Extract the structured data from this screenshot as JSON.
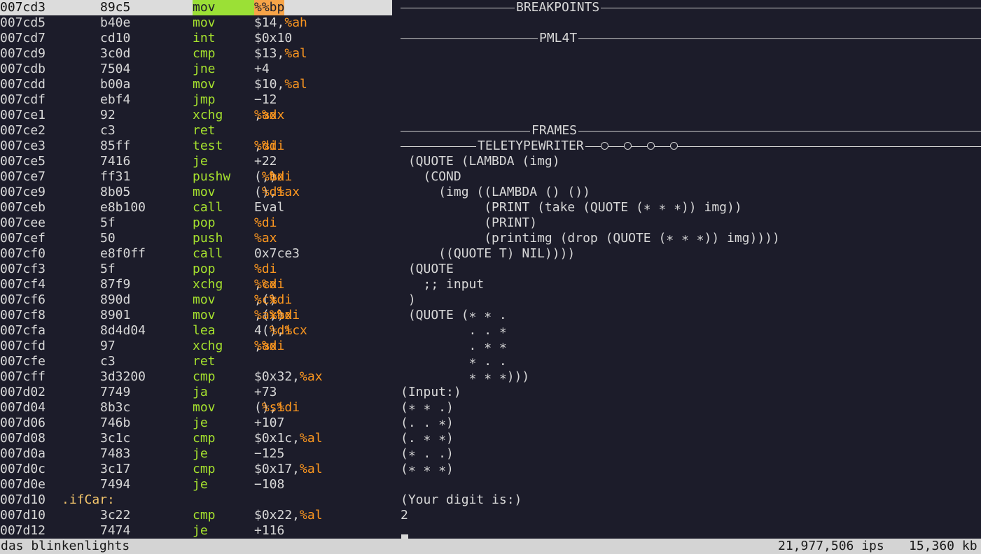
{
  "disassembly": {
    "rows": [
      {
        "addr": "007cd3",
        "hex": "89c5",
        "mn": "mov",
        "op": "<span class=\"reg hl\">%ax</span>,<span class=\"reg hl\">%bp</span>",
        "current": true
      },
      {
        "addr": "007cd5",
        "hex": "b40e",
        "mn": "mov",
        "op": "$14,<span class=\"reg\">%ah</span>"
      },
      {
        "addr": "007cd7",
        "hex": "cd10",
        "mn": "int",
        "op": "$0x10"
      },
      {
        "addr": "007cd9",
        "hex": "3c0d",
        "mn": "cmp",
        "op": "$13,<span class=\"reg\">%al</span>"
      },
      {
        "addr": "007cdb",
        "hex": "7504",
        "mn": "jne",
        "op": "+4"
      },
      {
        "addr": "007cdd",
        "hex": "b00a",
        "mn": "mov",
        "op": "$10,<span class=\"reg\">%al</span>"
      },
      {
        "addr": "007cdf",
        "hex": "ebf4",
        "mn": "jmp",
        "op": "−12"
      },
      {
        "addr": "007ce1",
        "hex": "92",
        "mn": "xchg",
        "op": "<span class=\"reg\">%ax</span>,<span class=\"reg\">%dx</span>"
      },
      {
        "addr": "007ce2",
        "hex": "c3",
        "mn": "ret",
        "op": ""
      },
      {
        "addr": "007ce3",
        "hex": "85ff",
        "mn": "test",
        "op": "<span class=\"reg\">%di</span>,<span class=\"reg\">%di</span>"
      },
      {
        "addr": "007ce5",
        "hex": "7416",
        "mn": "je",
        "op": "+22"
      },
      {
        "addr": "007ce7",
        "hex": "ff31",
        "mn": "pushw",
        "op": "(<span class=\"reg\">%bx</span>,<span class=\"reg\">%di</span>)"
      },
      {
        "addr": "007ce9",
        "hex": "8b05",
        "mn": "mov",
        "op": "(<span class=\"reg\">%di</span>),<span class=\"reg\">%ax</span>"
      },
      {
        "addr": "007ceb",
        "hex": "e8b100",
        "mn": "call",
        "op": "Eval"
      },
      {
        "addr": "007cee",
        "hex": "5f",
        "mn": "pop",
        "op": "<span class=\"reg\">%di</span>"
      },
      {
        "addr": "007cef",
        "hex": "50",
        "mn": "push",
        "op": "<span class=\"reg\">%ax</span>"
      },
      {
        "addr": "007cf0",
        "hex": "e8f0ff",
        "mn": "call",
        "op": "0x7ce3"
      },
      {
        "addr": "007cf3",
        "hex": "5f",
        "mn": "pop",
        "op": "<span class=\"reg\">%di</span>"
      },
      {
        "addr": "007cf4",
        "hex": "87f9",
        "mn": "xchg",
        "op": "<span class=\"reg\">%cx</span>,<span class=\"reg\">%di</span>"
      },
      {
        "addr": "007cf6",
        "hex": "890d",
        "mn": "mov",
        "op": "<span class=\"reg\">%cx</span>,(<span class=\"reg\">%di</span>)"
      },
      {
        "addr": "007cf8",
        "hex": "8901",
        "mn": "mov",
        "op": "<span class=\"reg\">%ax</span>,(<span class=\"reg\">%bx</span>,<span class=\"reg\">%di</span>)"
      },
      {
        "addr": "007cfa",
        "hex": "8d4d04",
        "mn": "lea",
        "op": "4(<span class=\"reg\">%di</span>),<span class=\"reg\">%cx</span>"
      },
      {
        "addr": "007cfd",
        "hex": "97",
        "mn": "xchg",
        "op": "<span class=\"reg\">%ax</span>,<span class=\"reg\">%di</span>"
      },
      {
        "addr": "007cfe",
        "hex": "c3",
        "mn": "ret",
        "op": ""
      },
      {
        "addr": "007cff",
        "hex": "3d3200",
        "mn": "cmp",
        "op": "$0x32,<span class=\"reg\">%ax</span>"
      },
      {
        "addr": "007d02",
        "hex": "7749",
        "mn": "ja",
        "op": "+73"
      },
      {
        "addr": "007d04",
        "hex": "8b3c",
        "mn": "mov",
        "op": "(<span class=\"reg\">%si</span>),<span class=\"reg\">%di</span>"
      },
      {
        "addr": "007d06",
        "hex": "746b",
        "mn": "je",
        "op": "+107"
      },
      {
        "addr": "007d08",
        "hex": "3c1c",
        "mn": "cmp",
        "op": "$0x1c,<span class=\"reg\">%al</span>"
      },
      {
        "addr": "007d0a",
        "hex": "7483",
        "mn": "je",
        "op": "−125"
      },
      {
        "addr": "007d0c",
        "hex": "3c17",
        "mn": "cmp",
        "op": "$0x17,<span class=\"reg\">%al</span>"
      },
      {
        "addr": "007d0e",
        "hex": "7494",
        "mn": "je",
        "op": "−108"
      },
      {
        "addr": "007d10",
        "label": ".ifCar:"
      },
      {
        "addr": "007d10",
        "hex": "3c22",
        "mn": "cmp",
        "op": "$0x22,<span class=\"reg\">%al</span>"
      },
      {
        "addr": "007d12",
        "hex": "7474",
        "mn": "je",
        "op": "+116"
      }
    ]
  },
  "panels": {
    "breakpoints": "BREAKPOINTS",
    "pml4t": "PML4T",
    "frames": "FRAMES",
    "teletype": "TELETYPEWRITER"
  },
  "teletype_lines": [
    " (QUOTE (LAMBDA (img)",
    "   (COND",
    "     (img ((LAMBDA () ())",
    "           (PRINT (take (QUOTE (∗ ∗ ∗)) img))",
    "           (PRINT)",
    "           (printimg (drop (QUOTE (∗ ∗ ∗)) img))))",
    "     ((QUOTE T) NIL))))",
    " (QUOTE",
    "   ;; input",
    " )",
    " (QUOTE (∗ ∗ .",
    "         . . ∗",
    "         . ∗ ∗",
    "         ∗ . .",
    "         ∗ ∗ ∗)))",
    "(Input:)",
    "(∗ ∗ .)",
    "(. . ∗)",
    "(. ∗ ∗)",
    "(∗ . .)",
    "(∗ ∗ ∗)",
    "",
    "(Your digit is:)",
    "2"
  ],
  "status": {
    "app_name": "das blinkenlights",
    "ips": "21,977,506 ips",
    "memory": "15,360 kb"
  },
  "colors": {
    "background": "#1c1c2a",
    "mnemonic": "#a6e22e",
    "register": "#fd971f",
    "label": "#f3c56b"
  }
}
